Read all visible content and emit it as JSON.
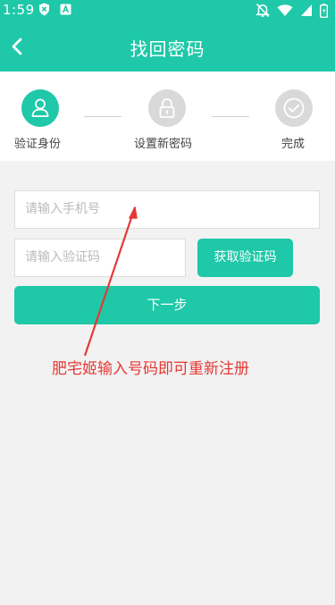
{
  "status_bar": {
    "time": "1:59"
  },
  "header": {
    "title": "找回密码"
  },
  "steps": [
    {
      "label": "验证身份",
      "state": "active",
      "icon": "user-icon"
    },
    {
      "label": "设置新密码",
      "state": "inactive",
      "icon": "lock-icon"
    },
    {
      "label": "完成",
      "state": "inactive",
      "icon": "check-icon"
    }
  ],
  "form": {
    "phone_placeholder": "请输入手机号",
    "code_placeholder": "请输入验证码",
    "get_code_label": "获取验证码",
    "next_label": "下一步"
  },
  "annotation": {
    "text": "肥宅姬输入号码即可重新注册"
  },
  "colors": {
    "accent": "#1ec8a8",
    "inactive_step": "#d9d9d9",
    "annotation": "#e53935",
    "background": "#f2f2f2"
  }
}
